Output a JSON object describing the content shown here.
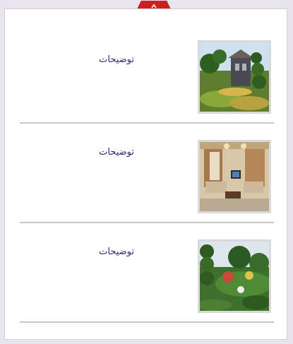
{
  "items": [
    {
      "description_label": "توضيحات",
      "thumbnail": "garden-villa-photo"
    },
    {
      "description_label": "توضيحات",
      "thumbnail": "living-room-photo"
    },
    {
      "description_label": "توضيحات",
      "thumbnail": "garden-lawn-photo"
    }
  ],
  "toggle": {
    "icon": "chevron-up-down-icon",
    "color": "#cc1f1f"
  },
  "colors": {
    "background": "#e9e4ed",
    "panel": "#ffffff",
    "label": "#3a1f7a",
    "separator": "#c9c9c9"
  }
}
